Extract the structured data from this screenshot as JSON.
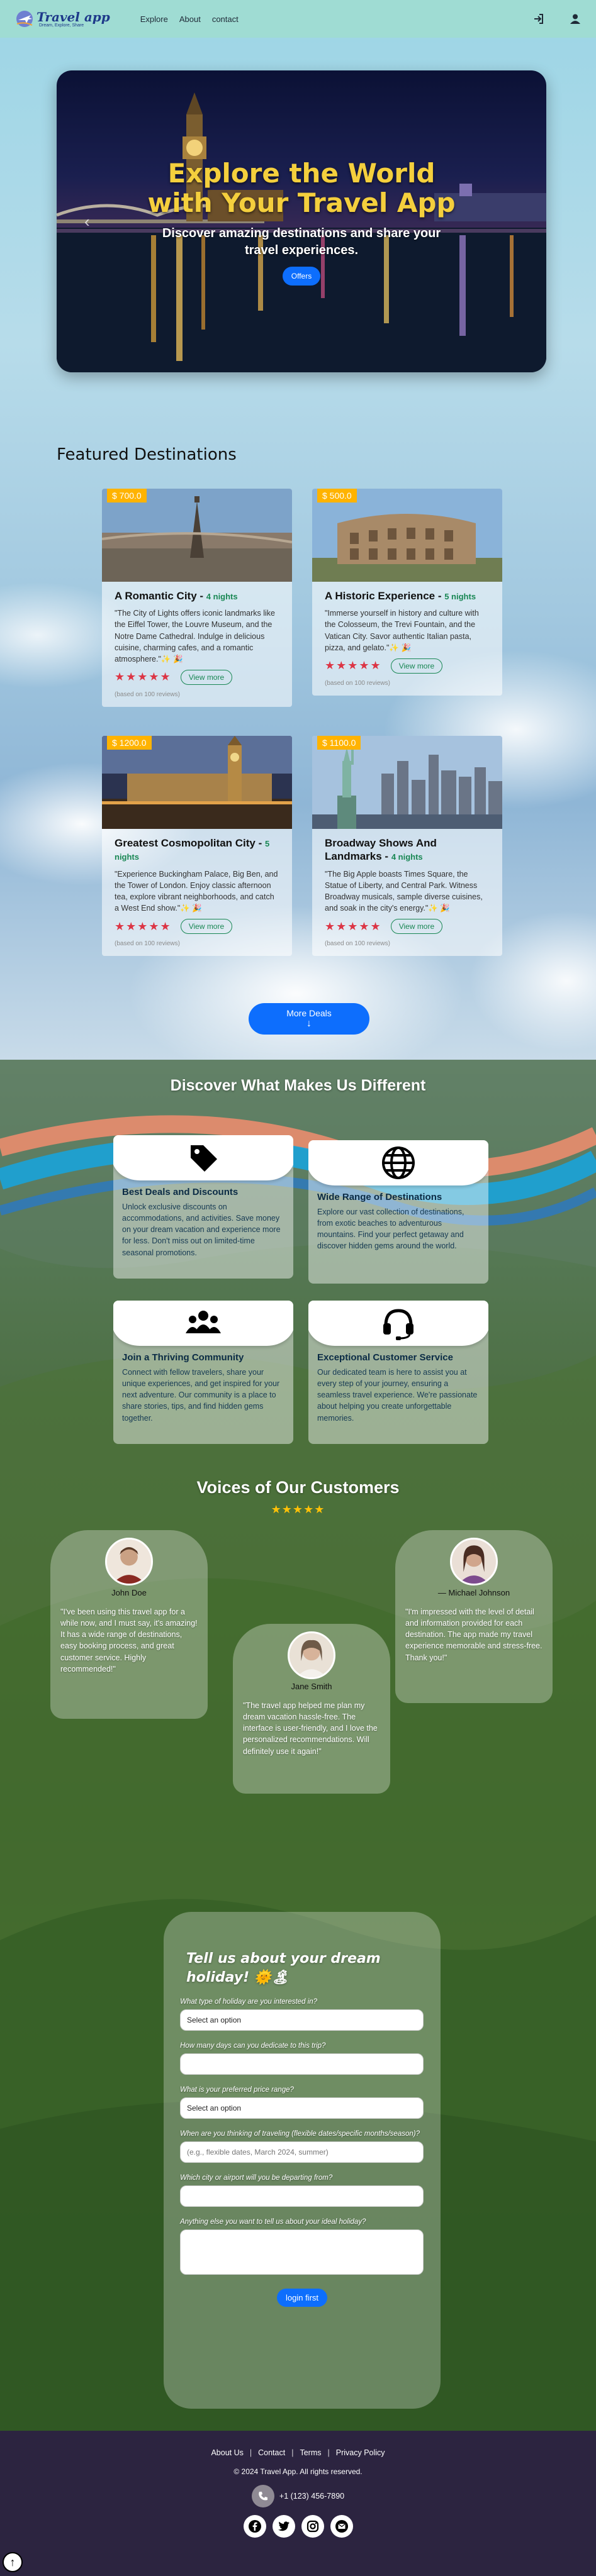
{
  "navbar": {
    "brand_title": "Travel app",
    "brand_sub": "Dream, Explore, Share",
    "links": [
      "Explore",
      "About",
      "contact"
    ]
  },
  "hero": {
    "title": "Explore the World with Your Travel App",
    "subtitle": "Discover amazing destinations and share your travel experiences.",
    "button": "Offers"
  },
  "featured": {
    "title": "Featured Destinations",
    "view_label": "View more",
    "stars": "★★★★★",
    "cards": [
      {
        "price": "$ 700.0",
        "name": "A Romantic City",
        "nights": "4 nights",
        "desc": "\"The City of Lights offers iconic landmarks like the Eiffel Tower, the Louvre Museum, and the Notre Dame Cathedral. Indulge in delicious cuisine, charming cafes, and a romantic atmosphere.\"✨ 🎉",
        "reviews": "(based on 100 reviews)"
      },
      {
        "price": "$ 500.0",
        "name": "A Historic Experience",
        "nights": "5 nights",
        "desc": "\"Immerse yourself in history and culture with the Colosseum, the Trevi Fountain, and the Vatican City. Savor authentic Italian pasta, pizza, and gelato.\"✨ 🎉",
        "reviews": "(based on 100 reviews)"
      },
      {
        "price": "$ 1200.0",
        "name": "Greatest Cosmopolitan City",
        "nights": "5 nights",
        "desc": "\"Experience Buckingham Palace, Big Ben, and the Tower of London. Enjoy classic afternoon tea, explore vibrant neighborhoods, and catch a West End show.\"✨ 🎉",
        "reviews": "(based on 100 reviews)"
      },
      {
        "price": "$ 1100.0",
        "name": "Broadway Shows And Landmarks",
        "nights": "4 nights",
        "desc": "\"The Big Apple boasts Times Square, the Statue of Liberty, and Central Park. Witness Broadway musicals, sample diverse cuisines, and soak in the city's energy.\"✨ 🎉",
        "reviews": "(based on 100 reviews)"
      }
    ],
    "more_button": "More Deals",
    "more_arrow": "↓"
  },
  "different": {
    "title": "Discover What Makes Us Different",
    "items": [
      {
        "icon": "tag-icon",
        "title": "Best Deals and Discounts",
        "text": "Unlock exclusive discounts on accommodations, and activities. Save money on your dream vacation and experience more for less. Don't miss out on limited-time seasonal promotions."
      },
      {
        "icon": "globe-icon",
        "title": "Wide Range of Destinations",
        "text": "Explore our vast collection of destinations, from exotic beaches to adventurous mountains. Find your perfect getaway and discover hidden gems around the world."
      },
      {
        "icon": "users-icon",
        "title": "Join a Thriving Community",
        "text": "Connect with fellow travelers, share your unique experiences, and get inspired for your next adventure. Our community is a place to share stories, tips, and find hidden gems together."
      },
      {
        "icon": "headset-icon",
        "title": "Exceptional Customer Service",
        "text": "Our dedicated team is here to assist you at every step of your journey, ensuring a seamless travel experience. We're passionate about helping you create unforgettable memories."
      }
    ]
  },
  "voices": {
    "title": "Voices of Our Customers",
    "stars": "★★★★★",
    "items": [
      {
        "name": "John Doe",
        "text": "\"I've been using this travel app for a while now, and I must say, it's amazing! It has a wide range of destinations, easy booking process, and great customer service. Highly recommended!\""
      },
      {
        "name": "Jane Smith",
        "text": "\"The travel app helped me plan my dream vacation hassle-free. The interface is user-friendly, and I love the personalized recommendations. Will definitely use it again!\""
      },
      {
        "name": "— Michael Johnson",
        "text": "\"I'm impressed with the level of detail and information provided for each destination. The app made my travel experience memorable and stress-free. Thank you!\""
      }
    ]
  },
  "form": {
    "title": "Tell us about your dream holiday! 🌞🏝",
    "fields": [
      {
        "label": "What type of holiday are you interested in?",
        "value": "Select an option"
      },
      {
        "label": "How many days can you dedicate to this trip?",
        "value": ""
      },
      {
        "label": "What is your preferred price range?",
        "value": "Select an option"
      },
      {
        "label": "When are you thinking of traveling (flexible dates/specific months/season)?",
        "placeholder": "(e.g., flexible dates, March 2024, summer)"
      },
      {
        "label": "Which city or airport will you be departing from?",
        "value": ""
      },
      {
        "label": "Anything else you want to tell us about your ideal holiday?",
        "value": ""
      }
    ],
    "submit": "login first"
  },
  "footer": {
    "links": [
      "About Us",
      "Contact",
      "Terms",
      "Privacy Policy"
    ],
    "copyright": "© 2024 Travel App. All rights reserved.",
    "phone": "+1 (123) 456-7890",
    "back_top": "↑"
  }
}
